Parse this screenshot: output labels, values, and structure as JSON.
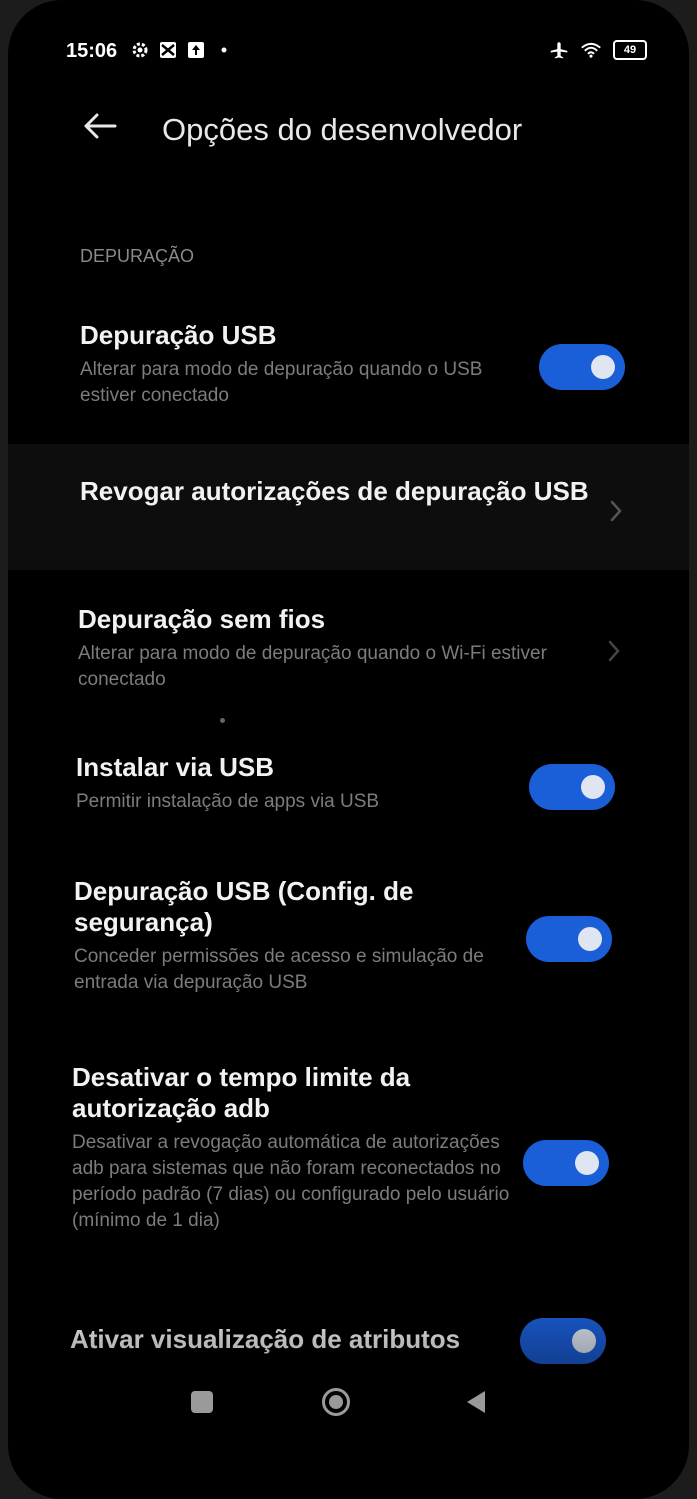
{
  "status_bar": {
    "time": "15:06",
    "left_icons": [
      "gear-icon",
      "photo-icon",
      "upload-icon",
      "dot-icon"
    ],
    "right_icons": [
      "airplane-icon",
      "wifi-icon"
    ],
    "battery": "49"
  },
  "header": {
    "back_icon": "back-arrow-icon",
    "title": "Opções do desenvolvedor"
  },
  "section": {
    "title": "DEPURAÇÃO"
  },
  "settings": [
    {
      "title": "Depuração USB",
      "subtitle": "Alterar para modo de depuração quando o USB estiver conectado",
      "control": "toggle",
      "enabled": true
    },
    {
      "title": "Revogar autorizações de depuração USB",
      "subtitle": "",
      "control": "chevron"
    },
    {
      "title": "Depuração sem fios",
      "subtitle": "Alterar para modo de depuração quando o Wi-Fi estiver conectado",
      "control": "chevron"
    },
    {
      "title": "Instalar via USB",
      "subtitle": "Permitir instalação de apps via USB",
      "control": "toggle",
      "enabled": true
    },
    {
      "title": "Depuração USB (Config. de segurança)",
      "subtitle": "Conceder permissões de acesso e simulação de entrada via depuração USB",
      "control": "toggle",
      "enabled": true
    },
    {
      "title": "Desativar o tempo limite da autorização adb",
      "subtitle": "Desativar a revogação automática de autorizações adb para sistemas que não foram reconectados no período padrão (7 dias) ou configurado pelo usuário (mínimo de 1 dia)",
      "control": "toggle",
      "enabled": true
    },
    {
      "title": "Ativar visualização de atributos",
      "subtitle": "",
      "control": "toggle",
      "enabled": true
    }
  ],
  "nav_bar": {
    "recents_icon": "recents-icon",
    "home_icon": "home-icon",
    "back_icon": "back-triangle-icon"
  },
  "colors": {
    "toggle_on": "#1a5ed8",
    "background": "#000000",
    "subtitle": "#7c7c7c"
  }
}
